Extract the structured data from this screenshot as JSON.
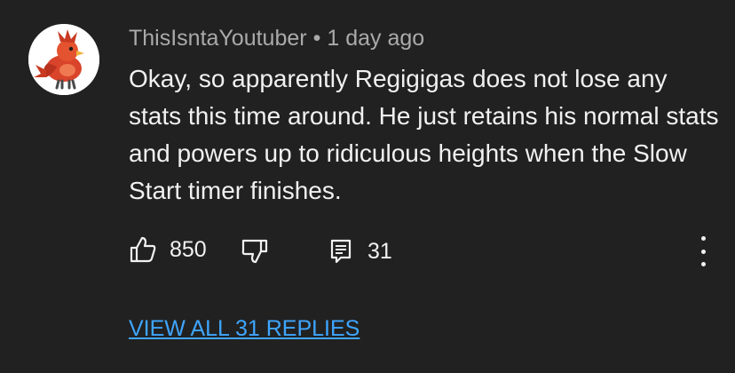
{
  "comment": {
    "author": "ThisIsntaYoutuber",
    "separator": "•",
    "time": "1 day ago",
    "text": "Okay, so apparently Regigigas does not lose any stats this time around. He just retains his normal stats and powers up to ridiculous heights when the Slow Start timer finishes.",
    "avatar_icon": "fire-bird-avatar"
  },
  "actions": {
    "like_icon": "thumbs-up-icon",
    "like_count": "850",
    "dislike_icon": "thumbs-down-icon",
    "reply_icon": "comment-icon",
    "reply_count": "31",
    "more_icon": "more-vertical-icon"
  },
  "replies": {
    "view_all_label": "VIEW ALL 31 REPLIES"
  },
  "colors": {
    "background": "#212121",
    "text": "#f1f1f1",
    "secondary_text": "#aaaaaa",
    "link": "#3ea6ff"
  }
}
